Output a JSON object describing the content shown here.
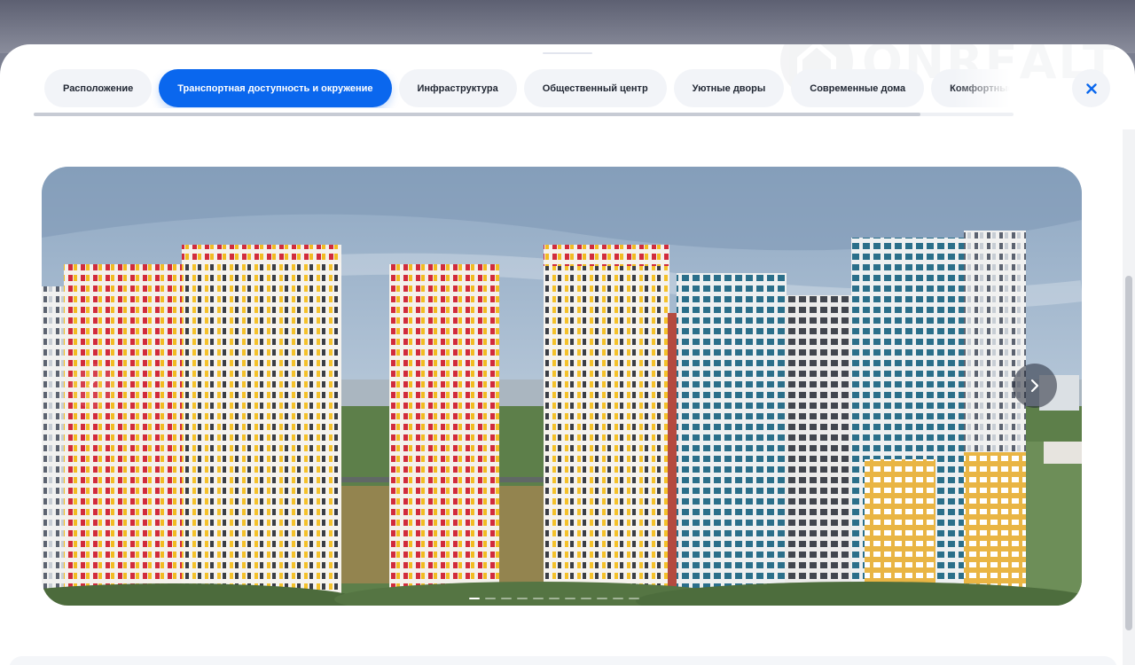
{
  "watermark": {
    "brand": "ONREALT"
  },
  "tabs": [
    {
      "label": "Расположение",
      "active": false
    },
    {
      "label": "Транспортная доступность и окружение",
      "active": true
    },
    {
      "label": "Инфраструктура",
      "active": false
    },
    {
      "label": "Общественный центр",
      "active": false
    },
    {
      "label": "Уютные дворы",
      "active": false
    },
    {
      "label": "Современные дома",
      "active": false
    },
    {
      "label": "Комфортные входные группы",
      "active": false
    }
  ],
  "close_button": {
    "icon": "close-icon"
  },
  "gallery": {
    "slide_count": 11,
    "active_slide": 1,
    "prev_icon": "chevron-left-icon",
    "next_icon": "chevron-right-icon"
  },
  "colors": {
    "accent": "#0a67ee",
    "tab_background": "#f2f4f8",
    "tab_text": "#222834",
    "close_icon": "#0a67ee"
  }
}
